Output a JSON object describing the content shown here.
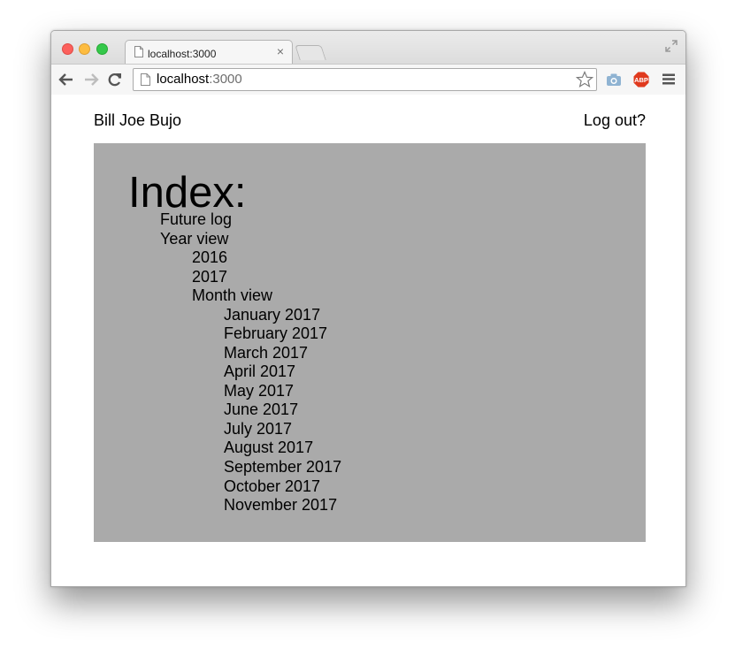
{
  "browser": {
    "tab_title": "localhost:3000",
    "tab_close_glyph": "×",
    "url_host": "localhost",
    "url_port": ":3000",
    "icons": {
      "close_button": "traffic-light-close",
      "minimize_button": "traffic-light-minimize",
      "maximize_button": "traffic-light-maximize",
      "tab_favicon": "page-icon",
      "back": "arrow-left-icon",
      "forward": "arrow-right-icon",
      "reload": "reload-icon",
      "bookmark": "star-icon",
      "camera_extension": "camera-icon",
      "adblock_extension": "abp-icon",
      "menu": "hamburger-menu-icon",
      "fullscreen": "fullscreen-icon"
    },
    "colors": {
      "close": "#fc605c",
      "minimize": "#fdbc40",
      "maximize": "#34c84a",
      "abp": "#e03a1e"
    }
  },
  "page": {
    "user_name": "Bill Joe Bujo",
    "logout_label": "Log out?",
    "panel_color": "#aaaaaa",
    "index": {
      "title": "Index:",
      "future_log": "Future log",
      "year_view": "Year view",
      "years": [
        "2016",
        "2017"
      ],
      "month_view": "Month view",
      "months": [
        "January 2017",
        "February 2017",
        "March 2017",
        "April 2017",
        "May 2017",
        "June 2017",
        "July 2017",
        "August 2017",
        "September 2017",
        "October 2017",
        "November 2017"
      ]
    }
  }
}
